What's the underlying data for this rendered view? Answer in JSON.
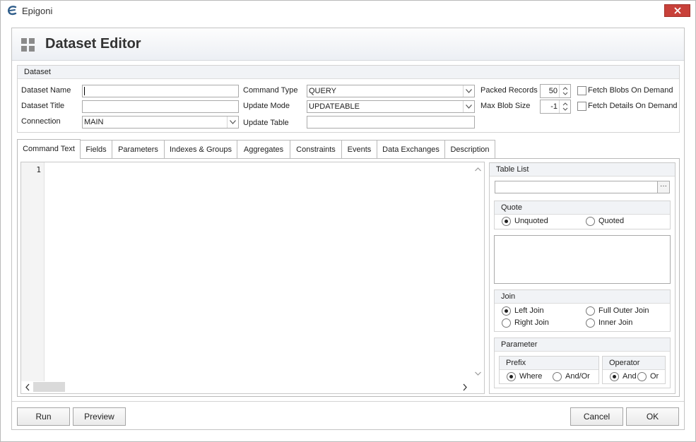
{
  "window": {
    "title": "Epigoni"
  },
  "page": {
    "title": "Dataset Editor"
  },
  "dataset": {
    "group_title": "Dataset",
    "name_label": "Dataset Name",
    "name_value": "",
    "title_label": "Dataset Title",
    "title_value": "",
    "connection_label": "Connection",
    "connection_value": "MAIN",
    "command_type_label": "Command Type",
    "command_type_value": "QUERY",
    "update_mode_label": "Update Mode",
    "update_mode_value": "UPDATEABLE",
    "update_table_label": "Update Table",
    "update_table_value": "",
    "packed_records_label": "Packed Records",
    "packed_records_value": "50",
    "max_blob_label": "Max Blob Size",
    "max_blob_value": "-1",
    "fetch_blobs_label": "Fetch Blobs On Demand",
    "fetch_blobs_checked": false,
    "fetch_details_label": "Fetch Details On Demand",
    "fetch_details_checked": false
  },
  "tabs": [
    {
      "label": "Command Text",
      "active": true
    },
    {
      "label": "Fields"
    },
    {
      "label": "Parameters"
    },
    {
      "label": "Indexes & Groups"
    },
    {
      "label": "Aggregates"
    },
    {
      "label": "Constraints"
    },
    {
      "label": "Events"
    },
    {
      "label": "Data Exchanges"
    },
    {
      "label": "Description"
    }
  ],
  "editor": {
    "line_numbers": [
      "1"
    ],
    "text": ""
  },
  "table_list": {
    "title": "Table List",
    "browse_label": "···",
    "quote": {
      "title": "Quote",
      "unquoted": "Unquoted",
      "quoted": "Quoted",
      "selected": "Unquoted"
    },
    "join": {
      "title": "Join",
      "left": "Left Join",
      "full_outer": "Full Outer Join",
      "right": "Right Join",
      "inner": "Inner Join",
      "selected": "Left Join"
    },
    "parameter": {
      "title": "Parameter",
      "prefix": {
        "title": "Prefix",
        "where": "Where",
        "and_or": "And/Or",
        "selected": "Where"
      },
      "operator": {
        "title": "Operator",
        "and": "And",
        "or": "Or",
        "selected": "And"
      }
    }
  },
  "footer": {
    "run": "Run",
    "preview": "Preview",
    "cancel": "Cancel",
    "ok": "OK"
  },
  "colors": {
    "close_button": "#c8413a",
    "header_bg": "#eceff4",
    "group_head": "#f1f3f6"
  },
  "icons": {
    "app": "epigoni-logo-icon",
    "page": "grid-icon",
    "close": "close-icon"
  }
}
